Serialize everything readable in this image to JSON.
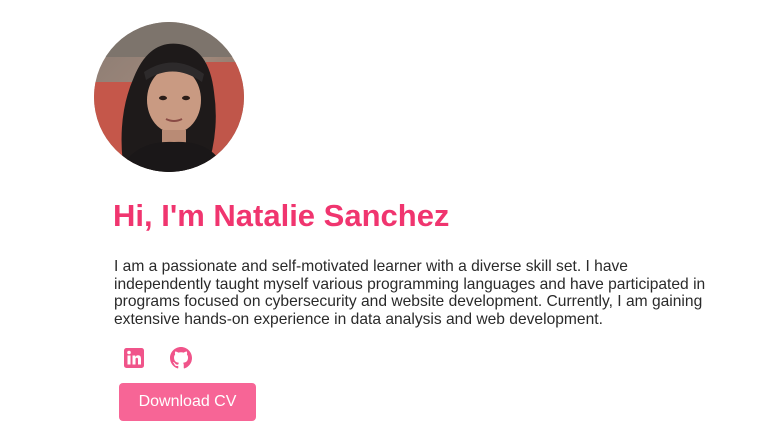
{
  "profile": {
    "greeting": "Hi, I'm Natalie Sanchez",
    "bio": "I am a passionate and self-motivated learner with a diverse skill set. I have independently taught myself various programming languages and have participated in programs focused on cybersecurity and website development. Currently, I am gaining extensive hands-on experience in data analysis and web development."
  },
  "socials": [
    {
      "icon": "linkedin-icon"
    },
    {
      "icon": "github-icon"
    }
  ],
  "actions": {
    "download_cv_label": "Download CV"
  },
  "colors": {
    "accent": "#f0356f",
    "icon": "#f0548a",
    "button": "#f76596",
    "text": "#2a2a2a"
  }
}
